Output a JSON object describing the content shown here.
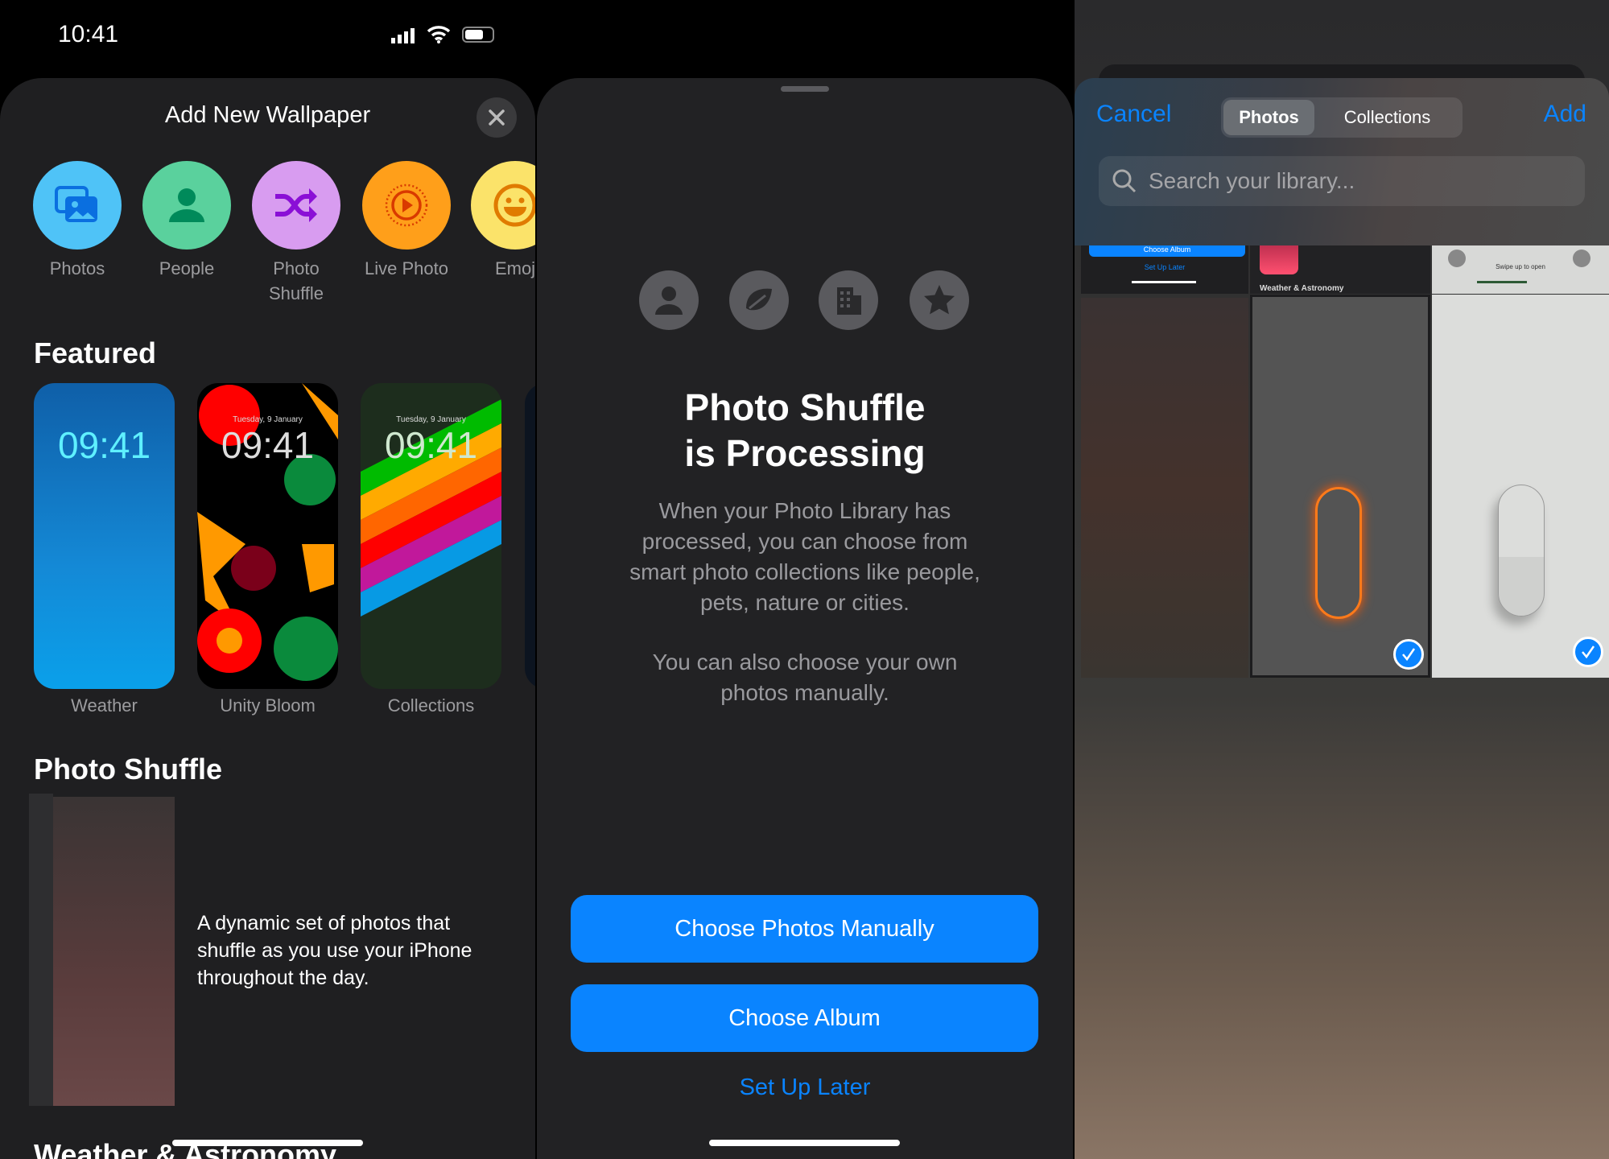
{
  "status_bar": {
    "time": "10:41"
  },
  "panel1": {
    "title": "Add New Wallpaper",
    "categories": [
      {
        "label": "Photos",
        "icon": "photos-icon",
        "color": "#4fc3f7"
      },
      {
        "label": "People",
        "icon": "person-icon",
        "color": "#5ad19d"
      },
      {
        "label": "Photo",
        "label2": "Shuffle",
        "icon": "shuffle-icon",
        "color": "#d89cf0"
      },
      {
        "label": "Live Photo",
        "icon": "live-photo-icon",
        "color": "#ff9f1a"
      },
      {
        "label": "Emoj",
        "icon": "emoji-icon",
        "color": "#fbe36a"
      }
    ],
    "featured_heading": "Featured",
    "featured": [
      {
        "label": "Weather",
        "time": "09:41"
      },
      {
        "label": "Unity Bloom",
        "time": "09:41",
        "date": "Tuesday, 9 January"
      },
      {
        "label": "Collections",
        "time": "09:41",
        "date": "Tuesday, 9 January"
      }
    ],
    "shuffle_heading": "Photo Shuffle",
    "shuffle_desc": [
      "A dynamic set of photos that",
      "shuffle as you use your iPhone",
      "throughout the day."
    ],
    "next_heading": "Weather & Astronomy"
  },
  "panel2": {
    "title": [
      "Photo Shuffle",
      "is Processing"
    ],
    "body": [
      "When your Photo Library has",
      "processed, you can choose from",
      "smart photo collections like people,",
      "pets, nature or cities."
    ],
    "body2": [
      "You can also choose your own",
      "photos manually."
    ],
    "icons": [
      "person-icon",
      "leaf-icon",
      "building-icon",
      "star-icon"
    ],
    "btn_manual": "Choose Photos Manually",
    "btn_album": "Choose Album",
    "setup_later": "Set Up Later",
    "accent": "#0a84ff"
  },
  "panel3": {
    "cancel": "Cancel",
    "tabs": [
      "Photos",
      "Collections"
    ],
    "active_tab": "Photos",
    "add": "Add",
    "search_placeholder": "Search your library...",
    "thumb_texts": {
      "choose_album": "Choose Album",
      "setup_later": "Set Up Later",
      "weather": "Weather & Astronomy",
      "swipe": "Swipe up to open"
    },
    "selected": [
      false,
      true,
      true
    ]
  }
}
